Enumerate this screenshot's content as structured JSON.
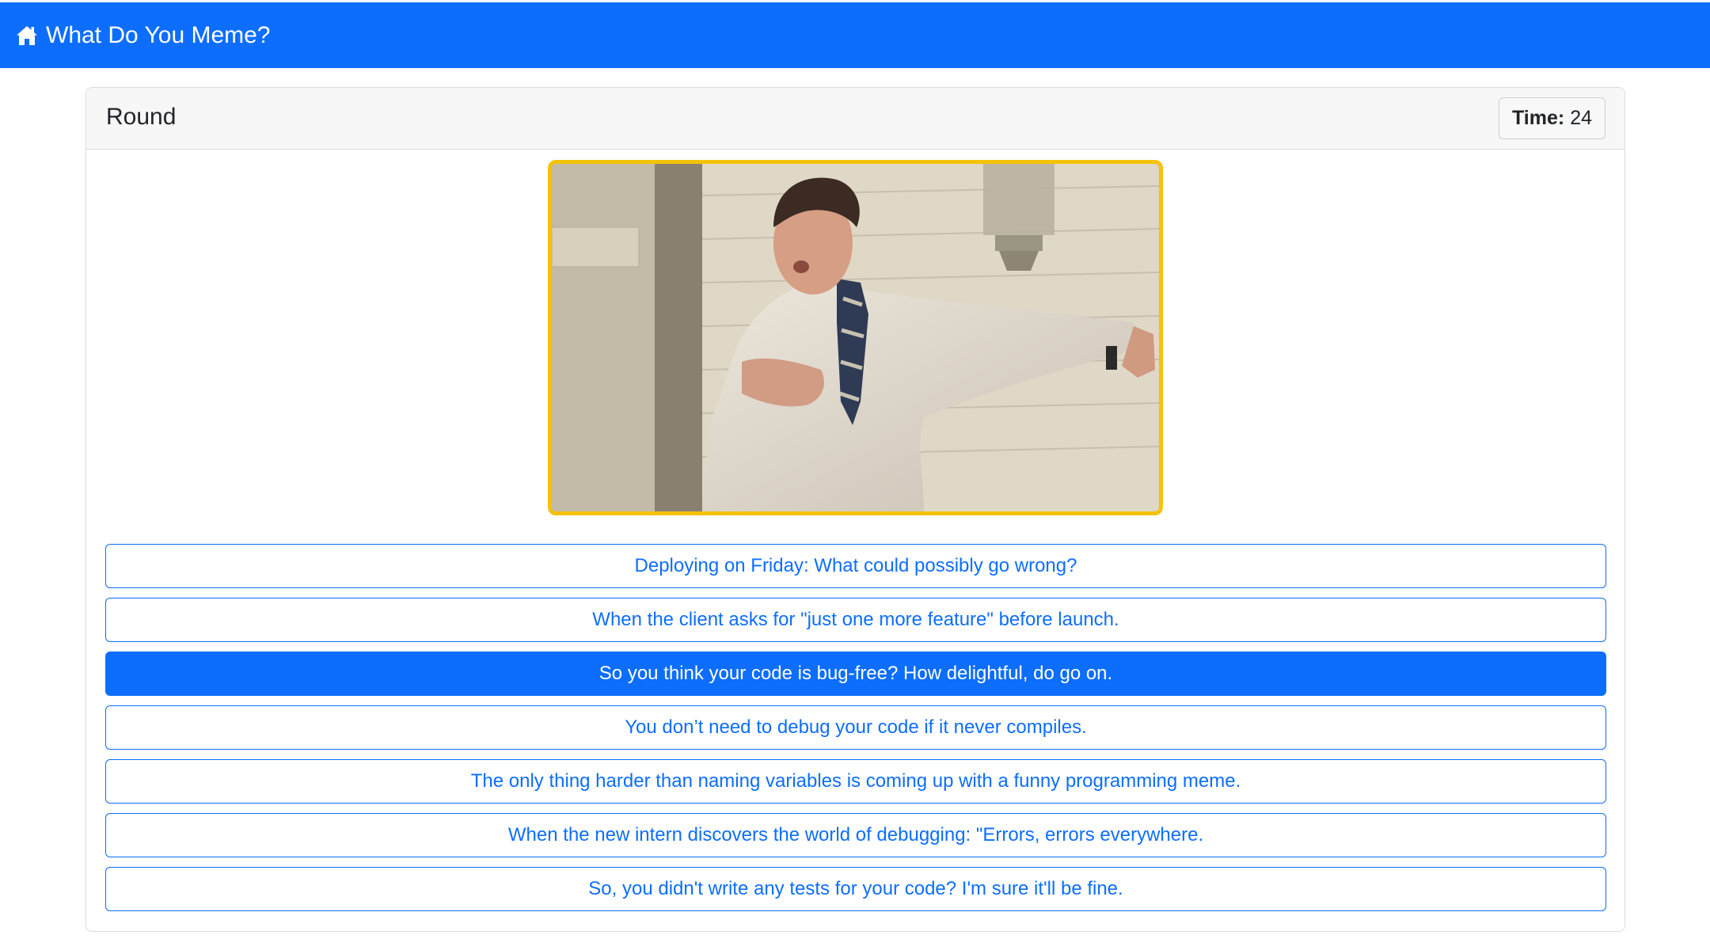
{
  "navbar": {
    "brand_icon": "home-icon",
    "brand_label": "What Do You Meme?"
  },
  "round": {
    "title": "Round",
    "timer_label": "Time:",
    "timer_value": "24"
  },
  "meme": {
    "image": "photo-man-clutching-chest-against-wall",
    "frame_color": "#f5c20b"
  },
  "captions": [
    {
      "text": "Deploying on Friday: What could possibly go wrong?",
      "selected": false
    },
    {
      "text": "When the client asks for \"just one more feature\" before launch.",
      "selected": false
    },
    {
      "text": "So you think your code is bug-free? How delightful, do go on.",
      "selected": true
    },
    {
      "text": "You don’t need to debug your code if it never compiles.",
      "selected": false
    },
    {
      "text": "The only thing harder than naming variables is coming up with a funny programming meme.",
      "selected": false
    },
    {
      "text": "When the new intern discovers the world of debugging: \"Errors, errors everywhere.",
      "selected": false
    },
    {
      "text": "So, you didn't write any tests for your code? I'm sure it'll be fine.",
      "selected": false
    }
  ],
  "colors": {
    "primary": "#0d6efd",
    "highlight": "#f5c20b"
  }
}
